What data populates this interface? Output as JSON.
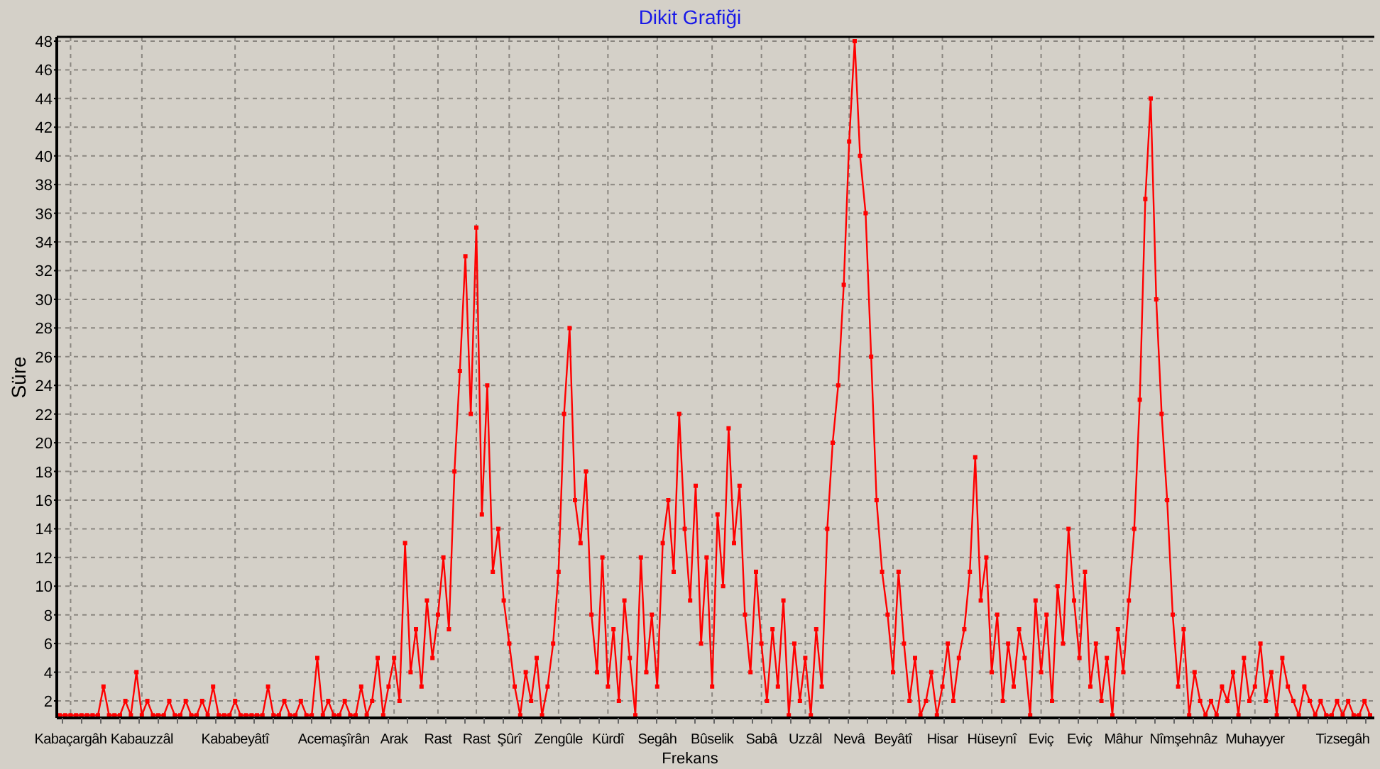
{
  "chart": {
    "chart_data": {
      "type": "line",
      "title": "Dikit Grafiği",
      "xlabel": "Frekans",
      "ylabel": "Süre",
      "grid": true,
      "ylim": [
        1,
        48
      ],
      "yticks": [
        2,
        4,
        6,
        8,
        10,
        12,
        14,
        16,
        18,
        20,
        22,
        24,
        26,
        28,
        30,
        32,
        34,
        36,
        38,
        40,
        42,
        44,
        46,
        48
      ],
      "series": [
        {
          "color": "#ff0000",
          "marker": "square",
          "values": [
            1,
            1,
            1,
            1,
            1,
            1,
            1,
            1,
            3,
            1,
            1,
            1,
            2,
            1,
            4,
            1,
            2,
            1,
            1,
            1,
            2,
            1,
            1,
            2,
            1,
            1,
            2,
            1,
            3,
            1,
            1,
            1,
            2,
            1,
            1,
            1,
            1,
            1,
            3,
            1,
            1,
            2,
            1,
            1,
            2,
            1,
            1,
            5,
            1,
            2,
            1,
            1,
            2,
            1,
            1,
            3,
            1,
            2,
            5,
            1,
            3,
            5,
            2,
            13,
            4,
            7,
            3,
            9,
            5,
            8,
            12,
            7,
            18,
            25,
            33,
            22,
            35,
            15,
            24,
            11,
            14,
            9,
            6,
            3,
            1,
            4,
            2,
            5,
            1,
            3,
            6,
            11,
            22,
            28,
            16,
            13,
            18,
            8,
            4,
            12,
            3,
            7,
            2,
            9,
            5,
            1,
            12,
            4,
            8,
            3,
            13,
            16,
            11,
            22,
            14,
            9,
            17,
            6,
            12,
            3,
            15,
            10,
            21,
            13,
            17,
            8,
            4,
            11,
            6,
            2,
            7,
            3,
            9,
            1,
            6,
            2,
            5,
            1,
            7,
            3,
            14,
            20,
            24,
            31,
            41,
            48,
            40,
            36,
            26,
            16,
            11,
            8,
            4,
            11,
            6,
            2,
            5,
            1,
            2,
            4,
            1,
            3,
            6,
            2,
            5,
            7,
            11,
            19,
            9,
            12,
            4,
            8,
            2,
            6,
            3,
            7,
            5,
            1,
            9,
            4,
            8,
            2,
            10,
            6,
            14,
            9,
            5,
            11,
            3,
            6,
            2,
            5,
            1,
            7,
            4,
            9,
            14,
            23,
            37,
            44,
            30,
            22,
            16,
            8,
            3,
            7,
            1,
            4,
            2,
            1,
            2,
            1,
            3,
            2,
            4,
            1,
            5,
            2,
            3,
            6,
            2,
            4,
            1,
            5,
            3,
            2,
            1,
            3,
            2,
            1,
            2,
            1,
            1,
            2,
            1,
            2,
            1,
            1,
            2,
            1
          ]
        }
      ]
    },
    "x_labels": [
      "Kabaçargâh",
      "Kabauzzâl",
      "Kababeyâtî",
      "Acemaşîrân",
      "Arak",
      "Rast",
      "Rast",
      "Şûrî",
      "Zengûle",
      "Kürdî",
      "Segâh",
      "Bûselik",
      "Sabâ",
      "Uzzâl",
      "Nevâ",
      "Beyâtî",
      "Hisar",
      "Hüseynî",
      "Eviç",
      "Eviç",
      "Mâhur",
      "Nîmşehnâz",
      "Muhayyer",
      "Tizsegâh"
    ]
  }
}
